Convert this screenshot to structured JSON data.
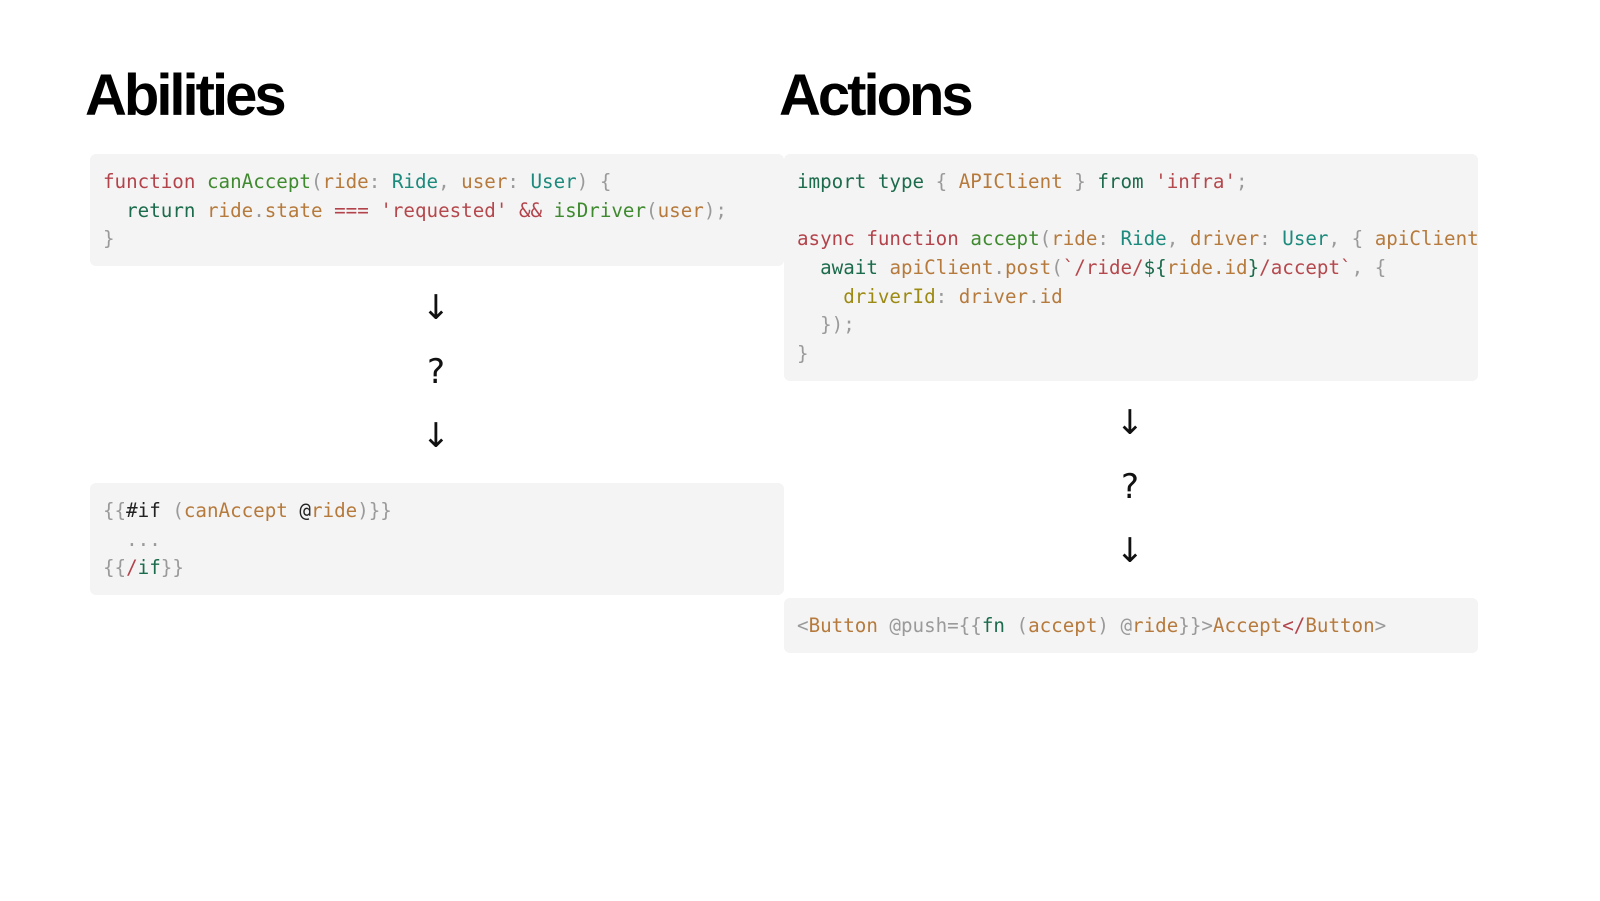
{
  "left": {
    "title": "Abilities",
    "code_top": [
      [
        [
          "function",
          "kw"
        ],
        [
          " ",
          "tx"
        ],
        [
          "canAccept",
          "fn"
        ],
        [
          "(",
          "pu"
        ],
        [
          "ride",
          "pa"
        ],
        [
          ": ",
          "pu"
        ],
        [
          "Ride",
          "ty"
        ],
        [
          ", ",
          "pu"
        ],
        [
          "user",
          "pa"
        ],
        [
          ": ",
          "pu"
        ],
        [
          "User",
          "ty"
        ],
        [
          ") {",
          "pu"
        ]
      ],
      [
        [
          "  ",
          "tx"
        ],
        [
          "return",
          "k2"
        ],
        [
          " ",
          "tx"
        ],
        [
          "ride",
          "pa"
        ],
        [
          ".",
          "pu"
        ],
        [
          "state",
          "pa"
        ],
        [
          " ",
          "tx"
        ],
        [
          "===",
          "kw"
        ],
        [
          " ",
          "tx"
        ],
        [
          "'requested'",
          "st"
        ],
        [
          " ",
          "tx"
        ],
        [
          "&&",
          "kw"
        ],
        [
          " ",
          "tx"
        ],
        [
          "isDriver",
          "fn"
        ],
        [
          "(",
          "pu"
        ],
        [
          "user",
          "pa"
        ],
        [
          ");",
          "pu"
        ]
      ],
      [
        [
          "}",
          "pu"
        ]
      ]
    ],
    "arrow_1": "↓",
    "question": "?",
    "arrow_2": "↓",
    "code_bottom": [
      [
        [
          "{{",
          "pu"
        ],
        [
          "#if",
          "tx"
        ],
        [
          " (",
          "pu"
        ],
        [
          "canAccept",
          "pa"
        ],
        [
          " ",
          "tx"
        ],
        [
          "@",
          "tx"
        ],
        [
          "ride",
          "pa"
        ],
        [
          ")}}",
          "pu"
        ]
      ],
      [
        [
          "  ...",
          "pu"
        ]
      ],
      [
        [
          "{{",
          "pu"
        ],
        [
          "/",
          "kw"
        ],
        [
          "if",
          "k2"
        ],
        [
          "}}",
          "pu"
        ]
      ]
    ]
  },
  "right": {
    "title": "Actions",
    "code_top": [
      [
        [
          "import",
          "k2"
        ],
        [
          " ",
          "tx"
        ],
        [
          "type",
          "k2"
        ],
        [
          " { ",
          "pu"
        ],
        [
          "APIClient",
          "pa"
        ],
        [
          " } ",
          "pu"
        ],
        [
          "from",
          "k2"
        ],
        [
          " ",
          "tx"
        ],
        [
          "'infra'",
          "st"
        ],
        [
          ";",
          "pu"
        ]
      ],
      [],
      [
        [
          "async",
          "kw"
        ],
        [
          " ",
          "tx"
        ],
        [
          "function",
          "kw"
        ],
        [
          " ",
          "tx"
        ],
        [
          "accept",
          "fn"
        ],
        [
          "(",
          "pu"
        ],
        [
          "ride",
          "pa"
        ],
        [
          ": ",
          "pu"
        ],
        [
          "Ride",
          "ty"
        ],
        [
          ", ",
          "pu"
        ],
        [
          "driver",
          "pa"
        ],
        [
          ": ",
          "pu"
        ],
        [
          "User",
          "ty"
        ],
        [
          ", { ",
          "pu"
        ],
        [
          "apiClient",
          "pa"
        ]
      ],
      [
        [
          "  ",
          "tx"
        ],
        [
          "await",
          "k2"
        ],
        [
          " ",
          "tx"
        ],
        [
          "apiClient",
          "pa"
        ],
        [
          ".",
          "pu"
        ],
        [
          "post",
          "pa"
        ],
        [
          "(",
          "pu"
        ],
        [
          "`/ride/",
          "st"
        ],
        [
          "${",
          "k2"
        ],
        [
          "ride.id",
          "pa"
        ],
        [
          "}",
          "k2"
        ],
        [
          "/accept`",
          "st"
        ],
        [
          ", {",
          "pu"
        ]
      ],
      [
        [
          "    ",
          "tx"
        ],
        [
          "driverId",
          "pr"
        ],
        [
          ": ",
          "pu"
        ],
        [
          "driver",
          "pa"
        ],
        [
          ".",
          "pu"
        ],
        [
          "id",
          "pa"
        ]
      ],
      [
        [
          "  });",
          "pu"
        ]
      ],
      [
        [
          "}",
          "pu"
        ]
      ]
    ],
    "arrow_1": "↓",
    "question": "?",
    "arrow_2": "↓",
    "code_bottom": [
      [
        [
          "<",
          "pu"
        ],
        [
          "Button",
          "pa"
        ],
        [
          " @push=",
          "pu"
        ],
        [
          "{{",
          "pu"
        ],
        [
          "fn",
          "k2"
        ],
        [
          " (",
          "pu"
        ],
        [
          "accept",
          "pa"
        ],
        [
          ") @",
          "pu"
        ],
        [
          "ride",
          "pa"
        ],
        [
          "}}>",
          "pu"
        ],
        [
          "Accept",
          "pa"
        ],
        [
          "</",
          "kw"
        ],
        [
          "Button",
          "pa"
        ],
        [
          ">",
          "pu"
        ]
      ]
    ]
  }
}
